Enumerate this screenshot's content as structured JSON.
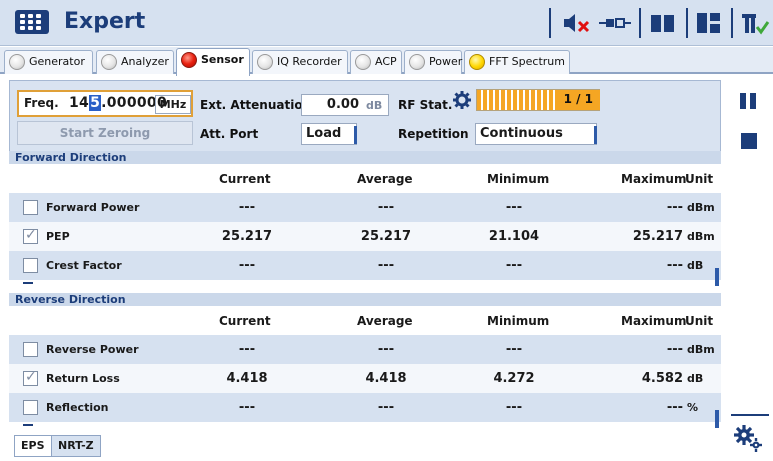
{
  "app": {
    "title": "Expert"
  },
  "titlebar_icons": [
    "mute-speaker-icon",
    "connection-plug-icon",
    "library-book-icon",
    "split-screen-icon",
    "sensor-logo-icon"
  ],
  "tabs": [
    {
      "label": "Generator",
      "led": "off"
    },
    {
      "label": "Analyzer",
      "led": "off"
    },
    {
      "label": "Sensor",
      "led": "red",
      "active": true
    },
    {
      "label": "IQ Recorder",
      "led": "off"
    },
    {
      "label": "ACP",
      "led": "off"
    },
    {
      "label": "Power",
      "led": "off"
    },
    {
      "label": "FFT Spectrum",
      "led": "yellow"
    }
  ],
  "config": {
    "freq_label": "Freq.",
    "freq_before_cursor": "14",
    "freq_cursor_digit": "5",
    "freq_after_cursor": ".000000",
    "freq_unit": "MHz",
    "start_zeroing": "Start Zeroing",
    "ext_att_label": "Ext. Attenuation",
    "ext_att_value": "0.00",
    "ext_att_unit": "dB",
    "att_port_label": "Att. Port",
    "att_port_value": "Load",
    "rf_stat_label": "RF Stat.",
    "rf_count": "1 / 1",
    "repetition_label": "Repetition",
    "repetition_value": "Continuous"
  },
  "columns": {
    "current": "Current",
    "average": "Average",
    "minimum": "Minimum",
    "maximum": "Maximum",
    "unit": "Unit"
  },
  "forward": {
    "title": "Forward Direction",
    "rows": [
      {
        "name": "Forward Power",
        "checked": false,
        "current": "---",
        "average": "---",
        "minimum": "---",
        "maximum": "---",
        "unit": "dBm"
      },
      {
        "name": "PEP",
        "checked": true,
        "current": "25.217",
        "average": "25.217",
        "minimum": "21.104",
        "maximum": "25.217",
        "unit": "dBm"
      },
      {
        "name": "Crest Factor",
        "checked": false,
        "current": "---",
        "average": "---",
        "minimum": "---",
        "maximum": "---",
        "unit": "dB"
      }
    ]
  },
  "reverse": {
    "title": "Reverse Direction",
    "rows": [
      {
        "name": "Reverse Power",
        "checked": false,
        "current": "---",
        "average": "---",
        "minimum": "---",
        "maximum": "---",
        "unit": "dBm"
      },
      {
        "name": "Return Loss",
        "checked": true,
        "current": "4.418",
        "average": "4.418",
        "minimum": "4.272",
        "maximum": "4.582",
        "unit": "dB"
      },
      {
        "name": "Reflection",
        "checked": false,
        "current": "---",
        "average": "---",
        "minimum": "---",
        "maximum": "---",
        "unit": "%"
      }
    ]
  },
  "bottom_tabs": [
    {
      "label": "EPS",
      "active": true
    },
    {
      "label": "NRT-Z",
      "active": false
    }
  ],
  "colors": {
    "accent": "#1c3d7a",
    "tab_bg": "#d6e1f0",
    "rf_bar": "#f5a623",
    "focus_border": "#e0a038"
  }
}
